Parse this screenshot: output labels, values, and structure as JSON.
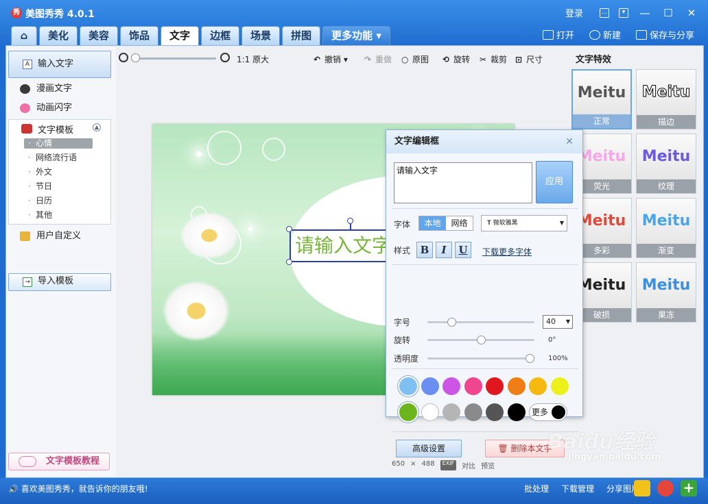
{
  "app": {
    "title": "美图秀秀 4.0.1",
    "logo": "秀"
  },
  "titlebar": {
    "login": "登录"
  },
  "tabs": [
    "美化",
    "美容",
    "饰品",
    "文字",
    "边框",
    "场景",
    "拼图",
    "更多功能"
  ],
  "active_tab": "文字",
  "top_actions": {
    "open": "打开",
    "new": "新建",
    "save_share": "保存与分享"
  },
  "left": {
    "input_text": "输入文字",
    "comic_text": "漫画文字",
    "animated_text": "动画闪字",
    "template_title": "文字模板",
    "template_items": [
      "心情",
      "网络流行语",
      "外文",
      "节日",
      "日历",
      "其他"
    ],
    "custom": "用户自定义",
    "import_template": "导入模板",
    "tutorial": "文字模板教程"
  },
  "toolbar": {
    "original_size": "1:1 原大",
    "undo": "撤销",
    "redo": "重做",
    "original": "原图",
    "rotate": "旋转",
    "crop": "裁剪",
    "size": "尺寸"
  },
  "zoom_level": 0.0,
  "canvas": {
    "text": "请输入文字",
    "width": "650",
    "height": "488",
    "x_sign": "×",
    "exif": "EXIF",
    "compare": "对比",
    "preview": "预览"
  },
  "dialog": {
    "title": "文字编辑框",
    "text_value": "请输入文字",
    "apply": "应用",
    "font_label": "字体",
    "font_local": "本地",
    "font_web": "网络",
    "font_name": "微软雅黑",
    "style_label": "样式",
    "bold": "B",
    "italic": "I",
    "underline": "U",
    "download_fonts": "下载更多字体",
    "size_label": "字号",
    "size_value": "40",
    "rotate_label": "旋转",
    "rotate_value": "0°",
    "opacity_label": "透明度",
    "opacity_value": "100%",
    "size_slider": 0.2,
    "rotate_slider": 0.5,
    "opacity_slider": 1.0,
    "colors_row1": [
      "#7fbff2",
      "#6b8ff0",
      "#cc55e6",
      "#f0468f",
      "#e0171f",
      "#f07e16",
      "#f6b90f",
      "#ecf01b"
    ],
    "colors_row2": [
      "#6cb51c",
      "#ffffff",
      "#b5b5b5",
      "#8a8a8a",
      "#555555",
      "#000000"
    ],
    "more_colors": "更多",
    "advanced": "高级设置",
    "delete": "删除本文字"
  },
  "effects": {
    "title": "文字特效",
    "items": [
      {
        "label": "正常",
        "preview": "Meitu",
        "color": "#555555"
      },
      {
        "label": "描边",
        "preview": "Meitu",
        "color": "#ffffff"
      },
      {
        "label": "荧光",
        "preview": "Meitu",
        "color": "#f7a6e8"
      },
      {
        "label": "纹理",
        "preview": "Meitu",
        "color": "#6a5ae0"
      },
      {
        "label": "多彩",
        "preview": "Meitu",
        "color": "#e04a3a"
      },
      {
        "label": "渐变",
        "preview": "Meitu",
        "color": "#4aa5e6"
      },
      {
        "label": "破损",
        "preview": "Meitu",
        "color": "#222222"
      },
      {
        "label": "果冻",
        "preview": "Meitu",
        "color": "#3b8fe0"
      }
    ]
  },
  "status": {
    "message": "喜欢美图秀秀，就告诉你的朋友哦!",
    "batch": "批处理",
    "download_manager": "下载管理",
    "share": "分享图片"
  },
  "watermark": {
    "main": "Baidu经验",
    "sub": "jingyan.baidu.com"
  }
}
